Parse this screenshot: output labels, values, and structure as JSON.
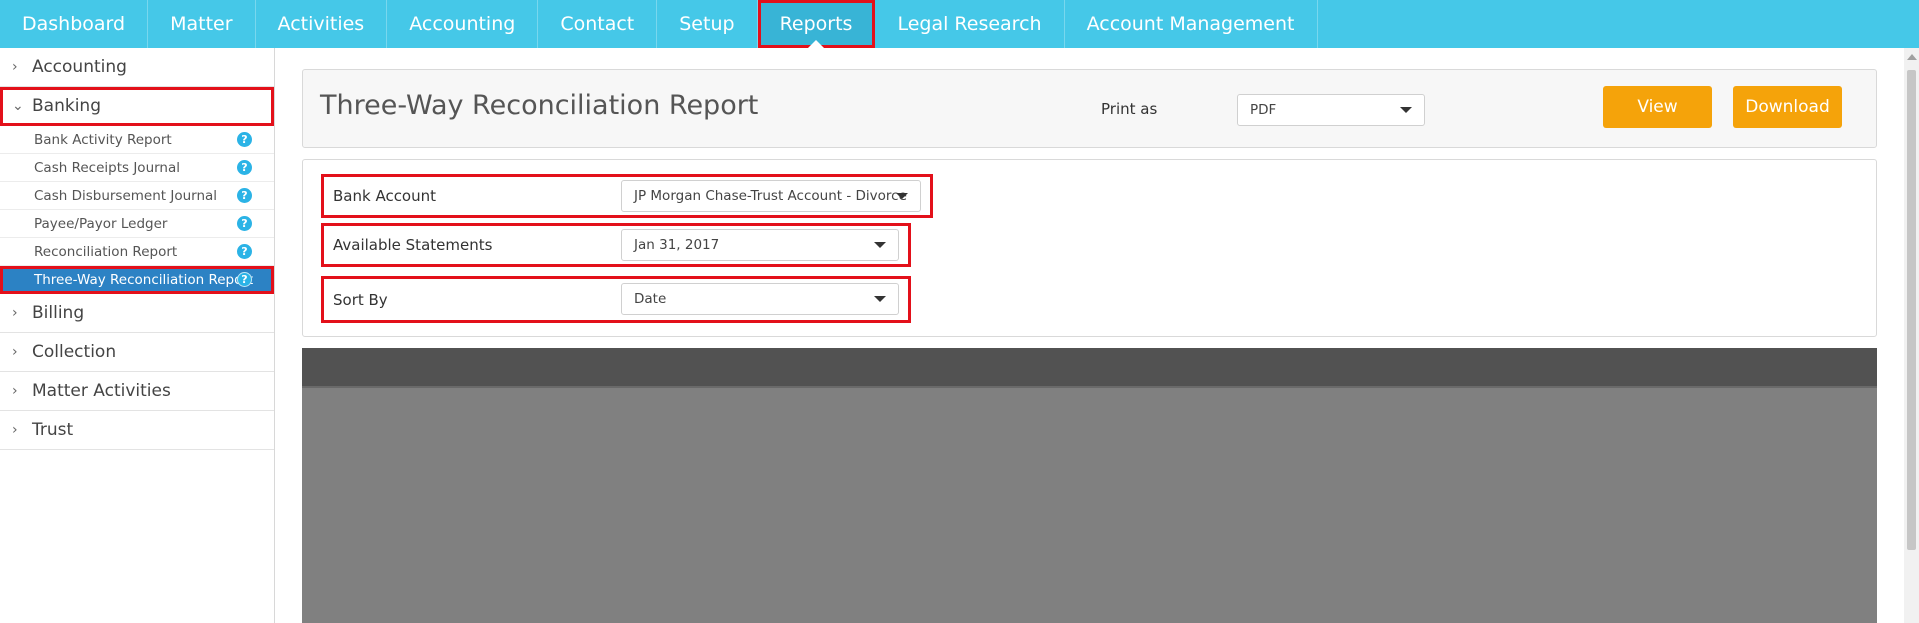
{
  "nav": {
    "items": [
      {
        "label": "Dashboard",
        "name": "nav-dashboard"
      },
      {
        "label": "Matter",
        "name": "nav-matter"
      },
      {
        "label": "Activities",
        "name": "nav-activities"
      },
      {
        "label": "Accounting",
        "name": "nav-accounting"
      },
      {
        "label": "Contact",
        "name": "nav-contact"
      },
      {
        "label": "Setup",
        "name": "nav-setup"
      },
      {
        "label": "Reports",
        "name": "nav-reports"
      },
      {
        "label": "Legal Research",
        "name": "nav-legal-research"
      },
      {
        "label": "Account Management",
        "name": "nav-account-management"
      }
    ],
    "active": "Reports"
  },
  "sidebar": {
    "categories": {
      "accounting": "Accounting",
      "banking": "Banking",
      "billing": "Billing",
      "collection": "Collection",
      "matter_activities": "Matter Activities",
      "trust": "Trust"
    },
    "banking_items": [
      {
        "label": "Bank Activity Report"
      },
      {
        "label": "Cash Receipts Journal"
      },
      {
        "label": "Cash Disbursement Journal"
      },
      {
        "label": "Payee/Payor Ledger"
      },
      {
        "label": "Reconciliation Report"
      },
      {
        "label": "Three-Way Reconciliation Report"
      }
    ],
    "help_glyph": "?"
  },
  "report": {
    "title": "Three-Way Reconciliation Report",
    "print_label": "Print as",
    "print_value": "PDF",
    "view_label": "View",
    "download_label": "Download"
  },
  "filters": {
    "bank_account_label": "Bank Account",
    "bank_account_value": "JP Morgan Chase-Trust Account - Divorce",
    "statements_label": "Available Statements",
    "statements_value": "Jan 31, 2017",
    "sort_label": "Sort By",
    "sort_value": "Date"
  },
  "colors": {
    "nav_bg": "#45c8e8",
    "accent_orange": "#f5a30a",
    "selected_blue": "#2c82c4",
    "highlight_red": "#e3101a"
  },
  "icons": {
    "collapsed": "chevron-right-icon",
    "expanded": "chevron-down-icon",
    "help": "help-circle-icon",
    "dropdown": "caret-down-icon"
  }
}
